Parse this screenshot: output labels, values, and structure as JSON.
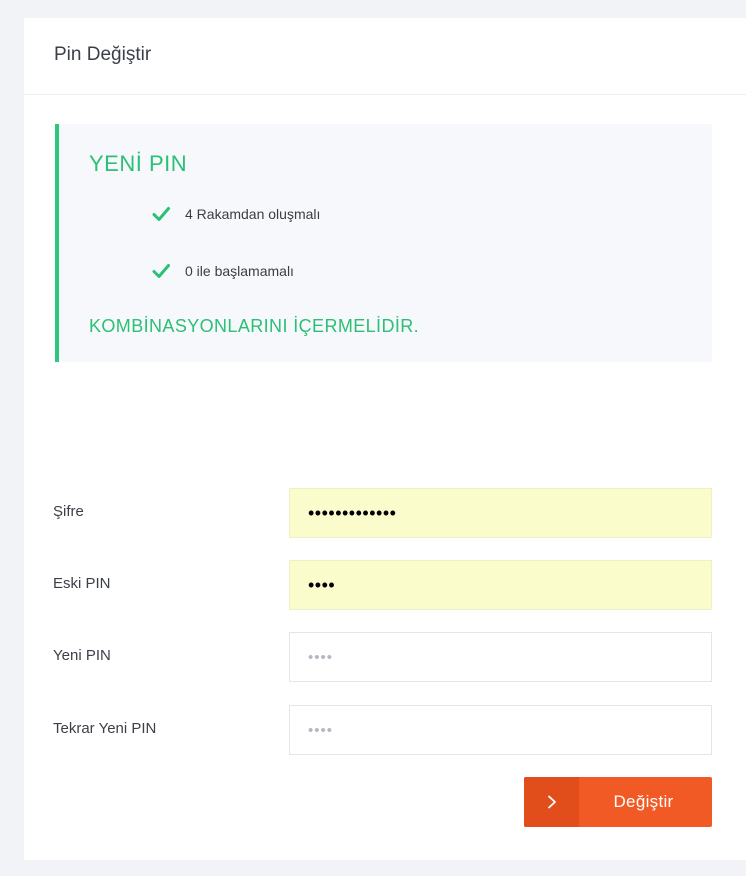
{
  "page": {
    "title": "Pin Değiştir"
  },
  "notice": {
    "title": "YENİ PIN",
    "rules": [
      {
        "icon": "check-icon",
        "text": "4 Rakamdan oluşmalı"
      },
      {
        "icon": "check-icon",
        "text": "0 ile başlamamalı"
      }
    ],
    "footer": "KOMBİNASYONLARINI İÇERMELİDİR.",
    "accent_color": "#2cbf76"
  },
  "form": {
    "fields": [
      {
        "label": "Şifre",
        "type": "password",
        "value": "•••••••••••••",
        "placeholder": ""
      },
      {
        "label": "Eski PIN",
        "type": "password",
        "value": "••••",
        "placeholder": ""
      },
      {
        "label": "Yeni PIN",
        "type": "password",
        "value": "",
        "placeholder": "••••"
      },
      {
        "label": "Tekrar Yeni PIN",
        "type": "password",
        "value": "",
        "placeholder": "••••"
      }
    ],
    "submit": {
      "label": "Değiştir",
      "icon": "chevron-right-icon",
      "color": "#f15a24"
    }
  }
}
